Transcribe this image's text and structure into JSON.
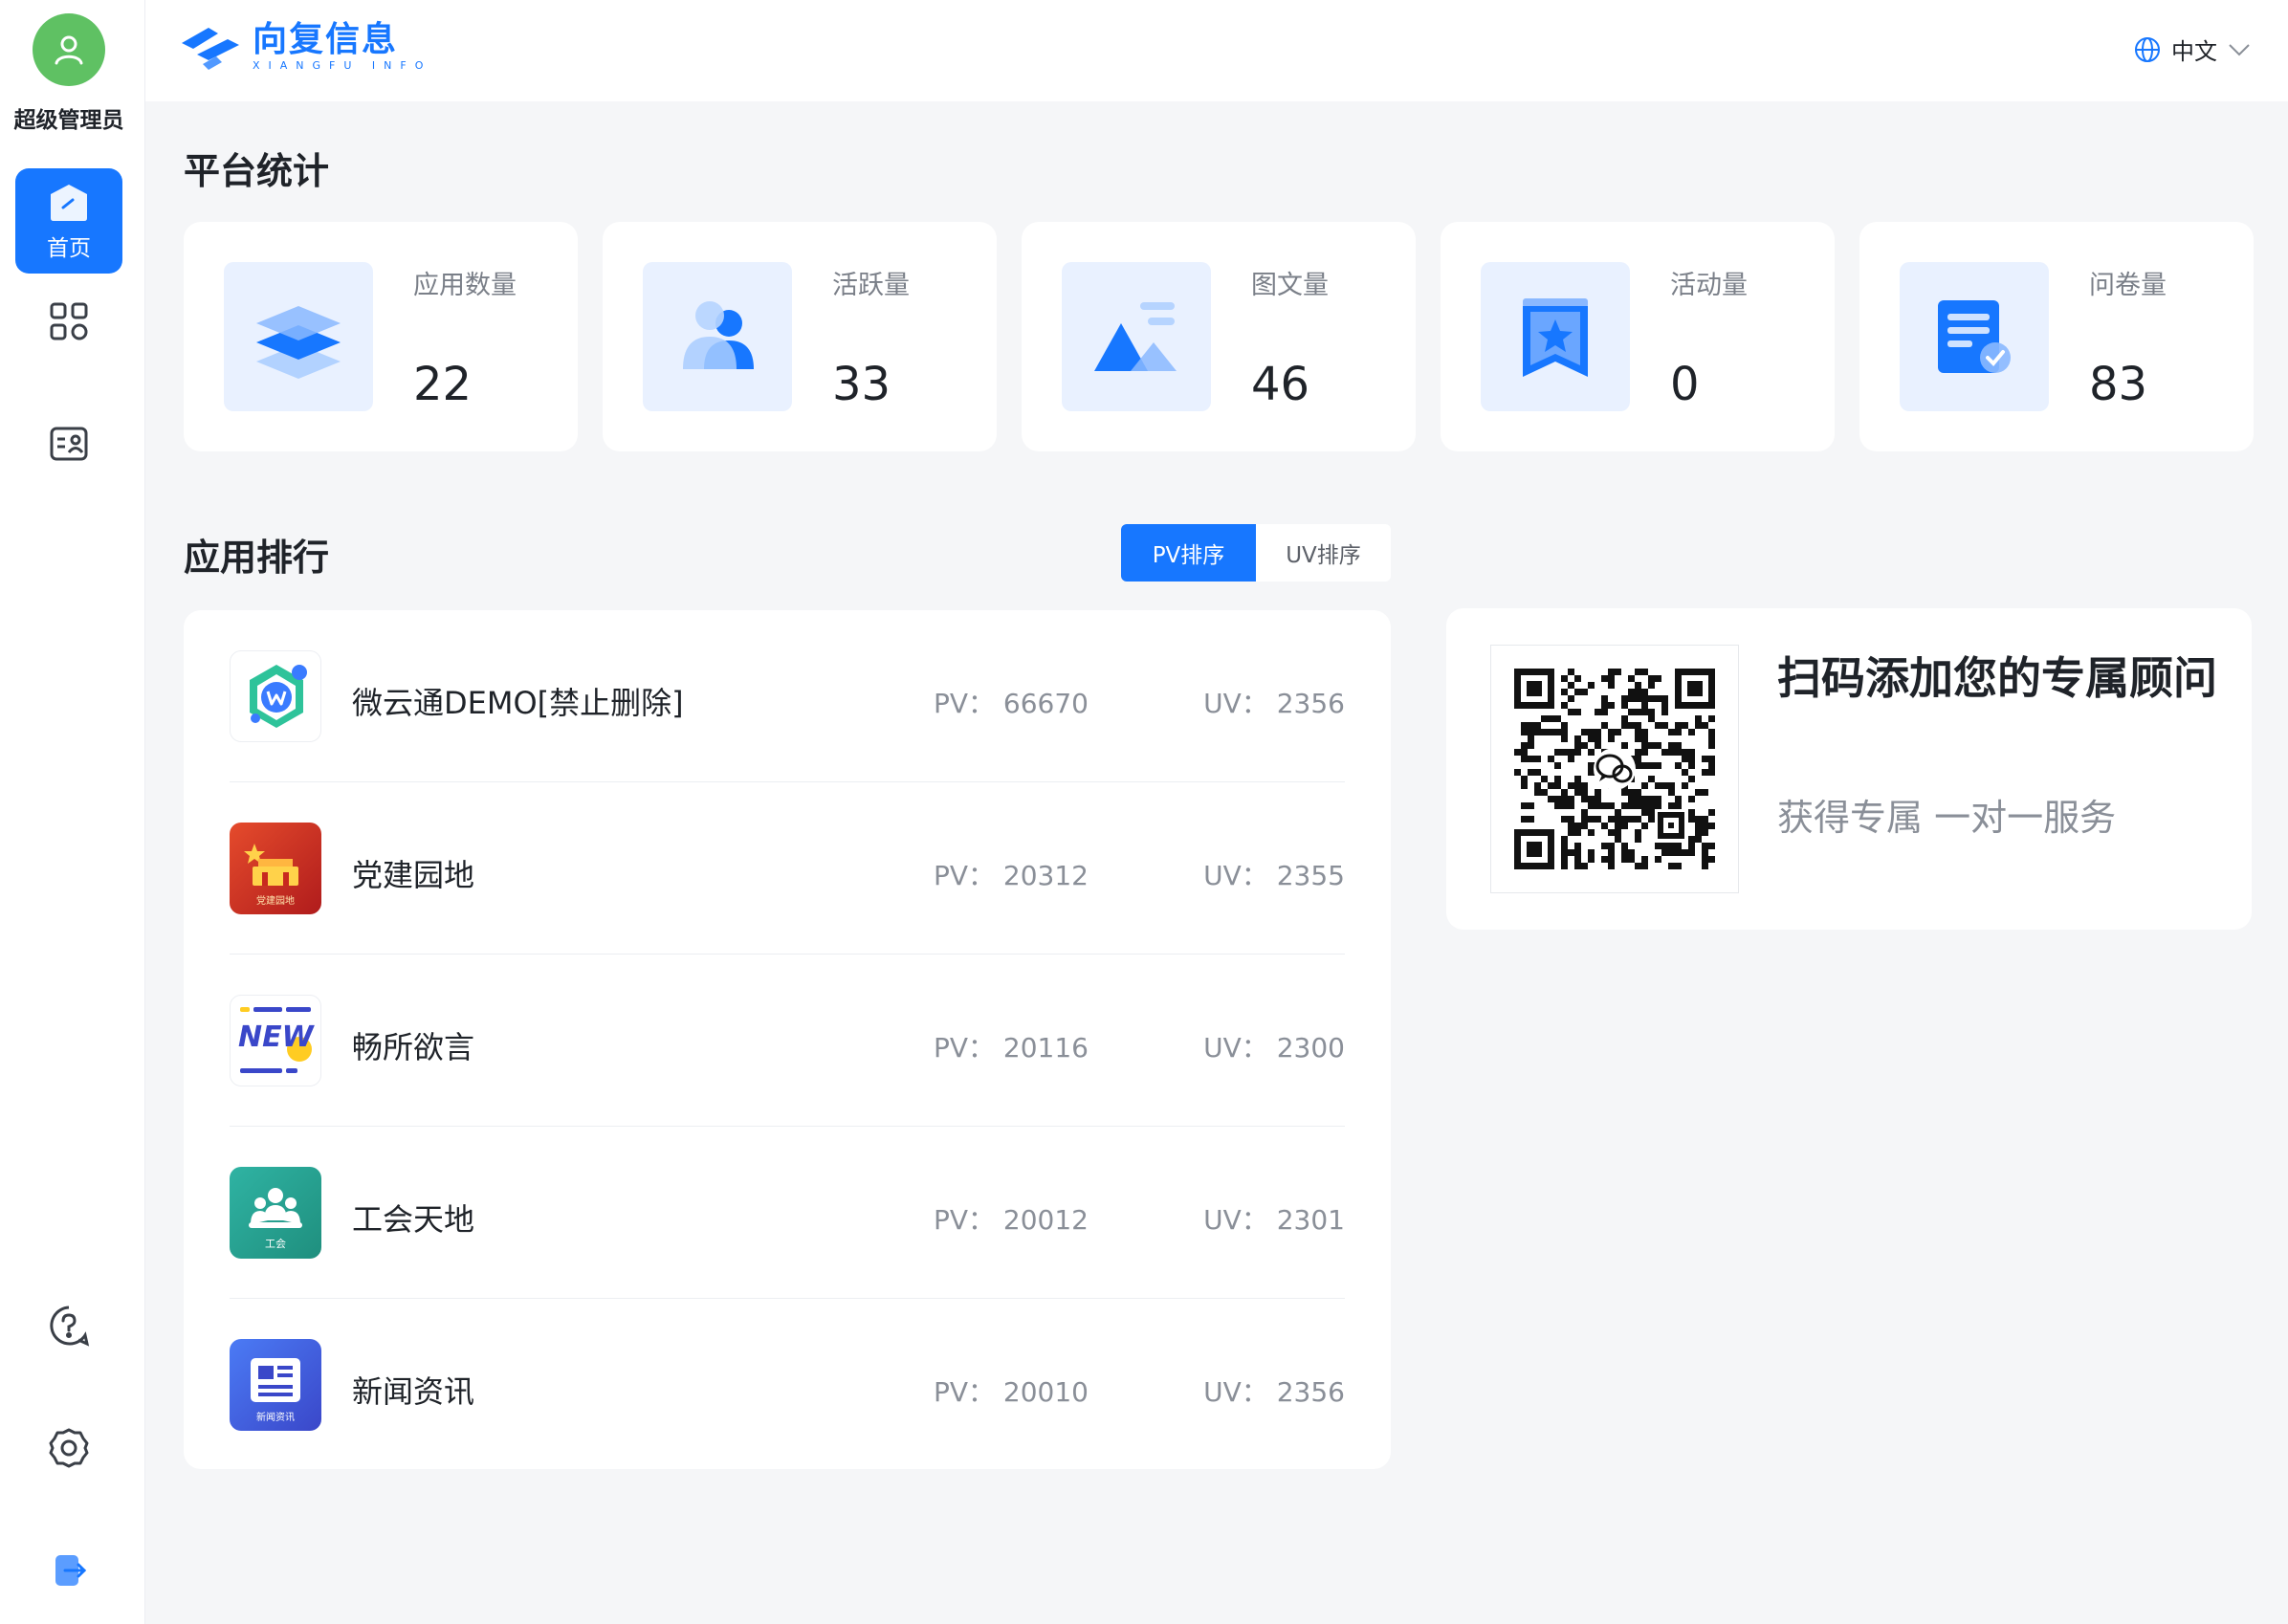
{
  "sidebar": {
    "user_name": "超级管理员",
    "home_label": "首页"
  },
  "header": {
    "logo_cn": "向复信息",
    "logo_en": "XIANGFU INFO",
    "language": "中文"
  },
  "stats": {
    "title": "平台统计",
    "cards": [
      {
        "label": "应用数量",
        "value": "22"
      },
      {
        "label": "活跃量",
        "value": "33"
      },
      {
        "label": "图文量",
        "value": "46"
      },
      {
        "label": "活动量",
        "value": "0"
      },
      {
        "label": "问卷量",
        "value": "83"
      }
    ]
  },
  "ranking": {
    "title": "应用排行",
    "tabs": [
      "PV排序",
      "UV排序"
    ],
    "pv_prefix": "PV：",
    "uv_prefix": "UV：",
    "items": [
      {
        "name": "微云通DEMO[禁止删除]",
        "pv": "66670",
        "uv": "2356"
      },
      {
        "name": "党建园地",
        "pv": "20312",
        "uv": "2355",
        "icon_caption": "党建园地"
      },
      {
        "name": "畅所欲言",
        "pv": "20116",
        "uv": "2300",
        "icon_caption": "NEW"
      },
      {
        "name": "工会天地",
        "pv": "20012",
        "uv": "2301",
        "icon_caption": "工会"
      },
      {
        "name": "新闻资讯",
        "pv": "20010",
        "uv": "2356",
        "icon_caption": "新闻资讯"
      }
    ]
  },
  "qr": {
    "title": "扫码添加您的专属顾问",
    "subtitle": "获得专属 一对一服务"
  },
  "colors": {
    "accent": "#1777ff",
    "avatar": "#5fc163"
  }
}
